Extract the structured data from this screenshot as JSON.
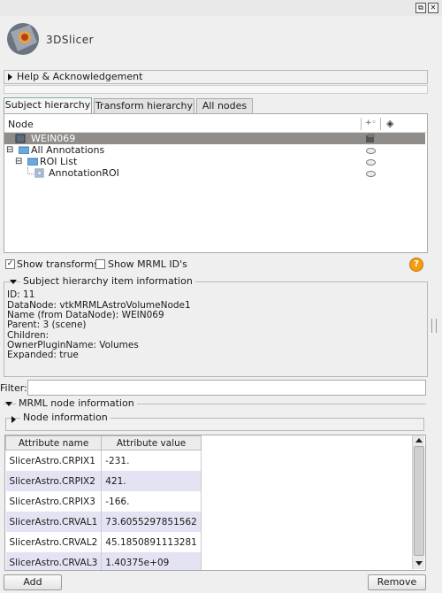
{
  "window": {
    "float_glyph": "⧉",
    "close_glyph": "✕"
  },
  "app": {
    "name": "3DSlicer"
  },
  "help_section": {
    "label": "Help & Acknowledgement"
  },
  "tabs": [
    {
      "label": "Subject hierarchy",
      "active": true
    },
    {
      "label": "Transform hierarchy",
      "active": false
    },
    {
      "label": "All nodes",
      "active": false
    }
  ],
  "tree": {
    "column_node": "Node",
    "column_transform_glyph": "+◦",
    "column_color_glyph": "◈",
    "rows": [
      {
        "label": "WEIN069",
        "level": 0,
        "selected": true,
        "icon": "volume-icon",
        "expander": ""
      },
      {
        "label": "All Annotations",
        "level": 0,
        "selected": false,
        "icon": "folder-icon",
        "expander": "⊟"
      },
      {
        "label": "ROI List",
        "level": 1,
        "selected": false,
        "icon": "folder-icon",
        "expander": "⊟"
      },
      {
        "label": "AnnotationROI",
        "level": 2,
        "selected": false,
        "icon": "roi-icon",
        "expander": ""
      }
    ]
  },
  "options": {
    "show_transforms": {
      "label": "Show transforms",
      "checked": true
    },
    "show_mrml_ids": {
      "label": "Show MRML ID's",
      "checked": false
    },
    "help_glyph": "?"
  },
  "item_info": {
    "title": "Subject hierarchy item information",
    "lines": [
      "ID: 11",
      "DataNode: vtkMRMLAstroVolumeNode1",
      "Name (from DataNode): WEIN069",
      "Parent: 3 (scene)",
      "Children:",
      "OwnerPluginName: Volumes",
      "Expanded: true"
    ]
  },
  "filter": {
    "label": "Filter:",
    "value": ""
  },
  "mrml_info": {
    "title": "MRML node information",
    "node_info_label": "Node information",
    "table": {
      "headers": [
        "Attribute name",
        "Attribute value"
      ],
      "rows": [
        [
          "SlicerAstro.CRPIX1",
          "-231."
        ],
        [
          "SlicerAstro.CRPIX2",
          "421."
        ],
        [
          "SlicerAstro.CRPIX3",
          "-166."
        ],
        [
          "SlicerAstro.CRVAL1",
          "73.6055297851562"
        ],
        [
          "SlicerAstro.CRVAL2",
          "45.1850891113281"
        ],
        [
          "SlicerAstro.CRVAL3",
          "1.40375e+09"
        ]
      ]
    }
  },
  "buttons": {
    "add": "Add",
    "remove": "Remove"
  },
  "colors": {
    "selection": "#8f8c89",
    "alt_row": "#e3e3f3",
    "help_orange": "#f39c12"
  }
}
